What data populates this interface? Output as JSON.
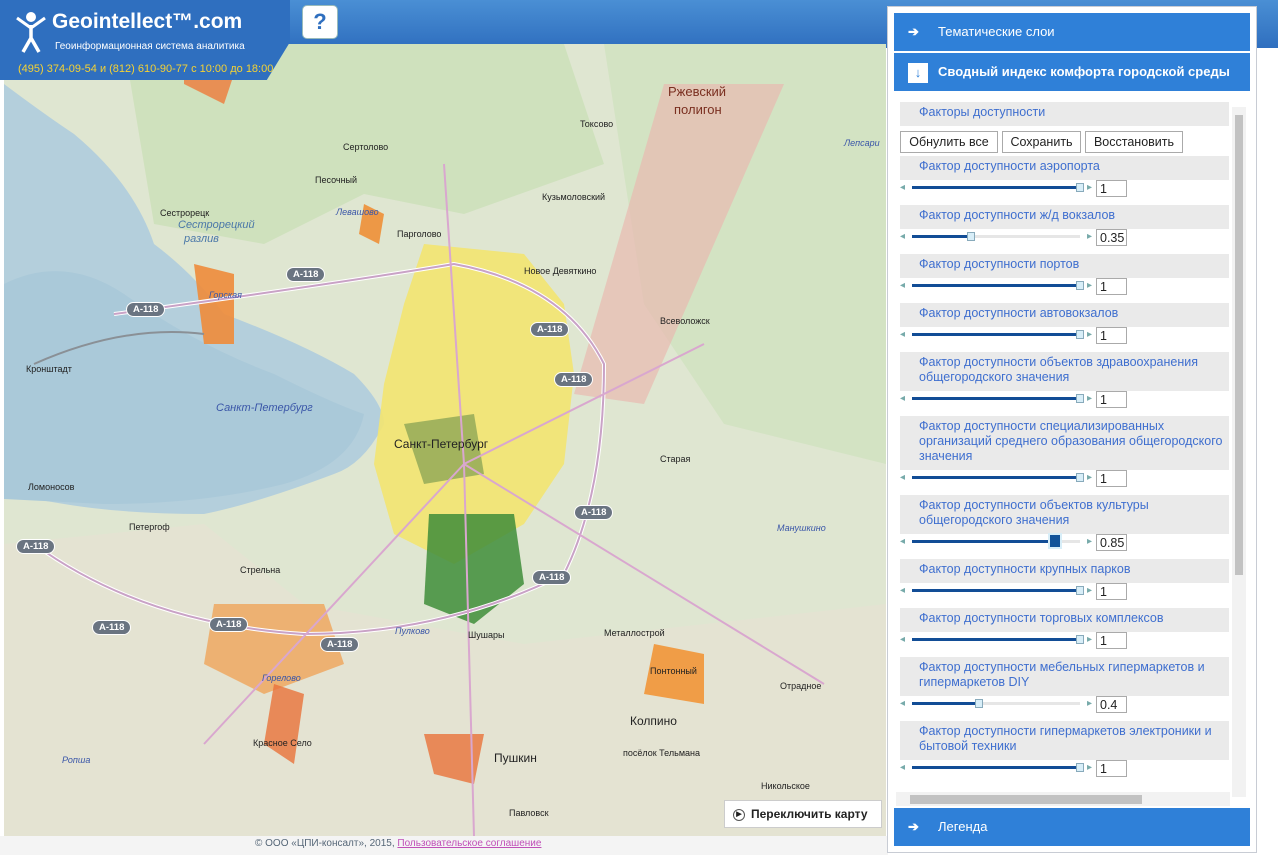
{
  "header": {
    "logo_title": "Geointellect™.com",
    "logo_subtitle": "Геоинформационная система аналитика",
    "phone": "(495) 374-09-54 и (812) 610-90-77 с 10:00 до 18:00",
    "help_label": "?"
  },
  "map": {
    "labels": {
      "rzhevsky": "Ржевский",
      "poligon": "полигон",
      "toksovo": "Токсово",
      "sertolovo": "Сертолово",
      "pesochny": "Песочный",
      "kuzmolovsky": "Кузьмоловский",
      "lepsari": "Лепсари",
      "sestroretsk": "Сестрорецк",
      "razliv1": "Сестрорецкий",
      "razliv2": "разлив",
      "levashovo": "Левашово",
      "pargolovo": "Парголово",
      "novoe_devyatkino": "Новое Девяткино",
      "vsevolozhsk": "Всеволожск",
      "gorskaya": "Горская",
      "kronshtadt": "Кронштадт",
      "spb_water": "Санкт-Петербург",
      "spb": "Санкт-Петербург",
      "staraya": "Старая",
      "lomonosov": "Ломоносов",
      "petergof": "Петергоф",
      "manushkino": "Манушкино",
      "strelna": "Стрельна",
      "pulkovo": "Пулково",
      "shushary": "Шушары",
      "metallostroy": "Металлострой",
      "pontonny": "Понтонный",
      "otradnoe": "Отрадное",
      "gorelovo": "Горелово",
      "krasnoe_selo": "Красное Село",
      "kolpino": "Колпино",
      "pushkin": "Пушкин",
      "telmana": "посёлок Тельмана",
      "ropsha": "Ропша",
      "nikolskoe": "Никольское",
      "pavlovsk": "Павловск",
      "road": "A-118"
    },
    "switch_label": "Переключить карту"
  },
  "footer": {
    "copyright": "© ООО «ЦПИ-консалт», 2015,",
    "agreement_link": "Пользовательское соглашение"
  },
  "panel": {
    "thematic_layers": "Тематические слои",
    "index_title": "Сводный индекс комфорта городской среды",
    "legend": "Легенда",
    "group_title": "Факторы доступности",
    "buttons": {
      "reset": "Обнулить все",
      "save": "Сохранить",
      "restore": "Восстановить"
    },
    "factors": [
      {
        "label": "Фактор доступности аэропорта",
        "value": "1",
        "fraction": 1.0
      },
      {
        "label": "Фактор доступности ж/д вокзалов",
        "value": "0.35",
        "fraction": 0.35
      },
      {
        "label": "Фактор доступности портов",
        "value": "1",
        "fraction": 1.0
      },
      {
        "label": "Фактор доступности автовокзалов",
        "value": "1",
        "fraction": 1.0
      },
      {
        "label": "Фактор доступности объектов здравоохранения общегородского значения",
        "value": "1",
        "fraction": 1.0
      },
      {
        "label": "Фактор доступности специализированных организаций среднего образования общегородского значения",
        "value": "1",
        "fraction": 1.0
      },
      {
        "label": "Фактор доступности объектов культуры общегородского значения",
        "value": "0.85",
        "fraction": 0.85
      },
      {
        "label": "Фактор доступности крупных парков",
        "value": "1",
        "fraction": 1.0
      },
      {
        "label": "Фактор доступности торговых комплексов",
        "value": "1",
        "fraction": 1.0
      },
      {
        "label": "Фактор доступности мебельных гипермаркетов и гипермаркетов DIY",
        "value": "0.4",
        "fraction": 0.4
      },
      {
        "label": "Фактор доступности гипермаркетов электроники и бытовой техники",
        "value": "1",
        "fraction": 1.0
      }
    ]
  }
}
